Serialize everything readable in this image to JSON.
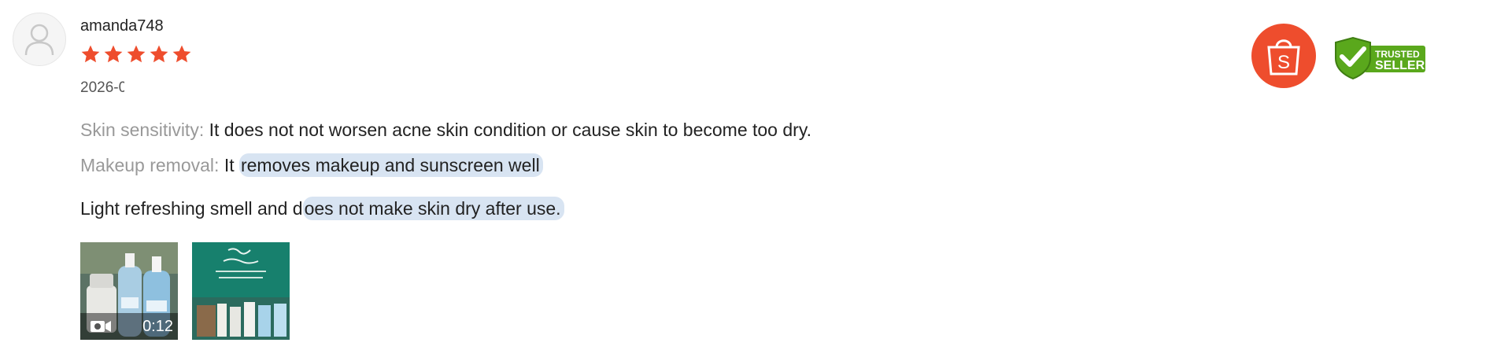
{
  "review": {
    "username": "amanda748",
    "rating": 5,
    "date": "2026-0",
    "attributes": [
      {
        "label": "Skin sensitivity:",
        "value": "It does not not worsen acne skin condition or cause skin to become too dry."
      },
      {
        "label": "Makeup removal:",
        "value_plain": "It ",
        "value_highlighted": "removes makeup and sunscreen well"
      }
    ],
    "comment": {
      "plain": "Light refreshing smell and d",
      "highlighted": "oes not make skin dry after use."
    },
    "media": [
      {
        "type": "video",
        "duration": "0:12",
        "icon": "video-camera-icon"
      },
      {
        "type": "image"
      }
    ]
  },
  "badges": {
    "shop_letter": "S",
    "trusted_line1": "TRUSTED",
    "trusted_line2": "SELLER"
  },
  "colors": {
    "star": "#ee4d2d",
    "shop": "#ee4d2d",
    "trusted_green": "#5aa81c",
    "highlight": "#d8e4f2"
  }
}
